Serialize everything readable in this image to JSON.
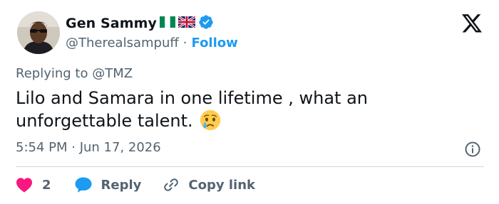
{
  "tweet": {
    "author": {
      "display_name": "Gen Sammy",
      "handle": "@Therealsampuff",
      "follow_label": "Follow",
      "separator": "·",
      "flags": [
        "nigeria-flag",
        "uk-flag"
      ],
      "verified": true
    },
    "reply_prefix": "Replying to",
    "reply_mention": "@TMZ",
    "text": "Lilo and Samara in one lifetime , what an unforgettable talent.",
    "emoji": "crying-face-emoji",
    "timestamp": "5:54 PM · Jun 17, 2026",
    "actions": {
      "like_count": "2",
      "reply_label": "Reply",
      "copy_label": "Copy link"
    }
  },
  "colors": {
    "accent": "#1d9bf0",
    "like": "#f91880",
    "text_primary": "#0f1419",
    "text_secondary": "#536471",
    "divider": "#cfd9de"
  }
}
